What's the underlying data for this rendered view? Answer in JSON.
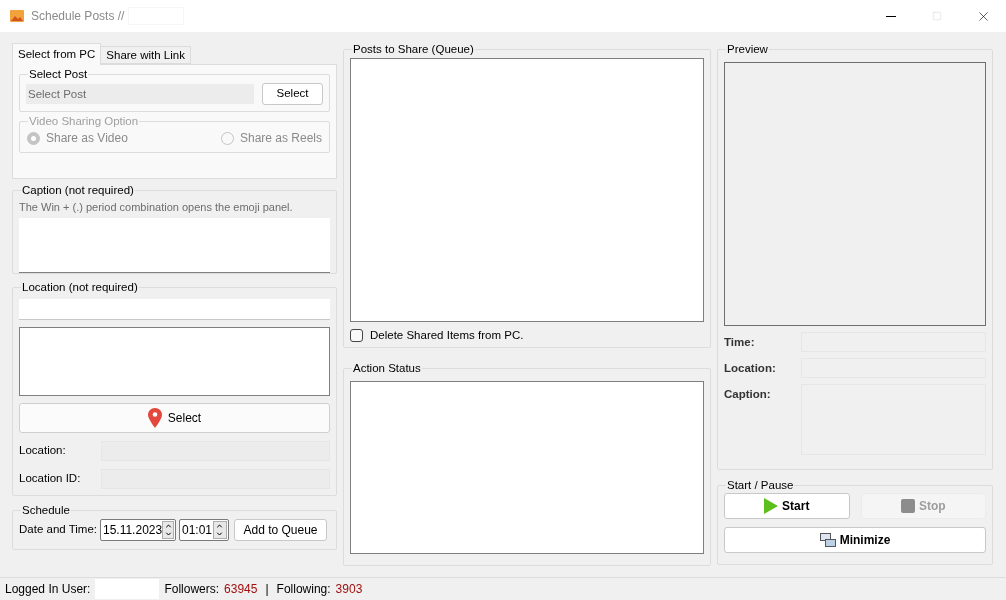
{
  "window": {
    "title": "Schedule Posts //"
  },
  "tabs": [
    {
      "label": "Select from PC",
      "selected": true
    },
    {
      "label": "Share with Link",
      "selected": false
    }
  ],
  "select_post": {
    "title": "Select Post",
    "placeholder": "Select Post",
    "button": "Select"
  },
  "video_option": {
    "title": "Video Sharing Option",
    "disabled": true,
    "options": [
      {
        "label": "Share as Video",
        "selected": true
      },
      {
        "label": "Share as Reels",
        "selected": false
      }
    ]
  },
  "caption": {
    "title": "Caption (not required)",
    "hint": "The Win + (.) period combination opens the emoji panel."
  },
  "location": {
    "title": "Location (not required)",
    "button": "Select",
    "fields": [
      {
        "label": "Location:"
      },
      {
        "label": "Location ID:"
      }
    ]
  },
  "schedule": {
    "title": "Schedule",
    "label": "Date and Time:",
    "date": "15.11.2023",
    "time": "01:01",
    "button": "Add to Queue"
  },
  "queue": {
    "title": "Posts to Share (Queue)",
    "delete_option": {
      "label": "Delete Shared Items from PC.",
      "checked": false
    }
  },
  "action_status": {
    "title": "Action Status"
  },
  "preview": {
    "title": "Preview",
    "fields": [
      {
        "label": "Time:",
        "kind": "line"
      },
      {
        "label": "Location:",
        "kind": "line"
      },
      {
        "label": "Caption:",
        "kind": "multiline"
      }
    ]
  },
  "controls": {
    "title": "Start / Pause",
    "buttons": [
      {
        "label": "Start",
        "kind": "start",
        "disabled": false
      },
      {
        "label": "Stop",
        "kind": "stop",
        "disabled": true
      },
      {
        "label": "Minimize",
        "kind": "minimize",
        "disabled": false
      }
    ]
  },
  "status_bar": {
    "user_label": "Logged In User:",
    "followers_label": "Followers:",
    "followers": "63945",
    "separator": "|",
    "following_label": "Following:",
    "following": "3903"
  }
}
